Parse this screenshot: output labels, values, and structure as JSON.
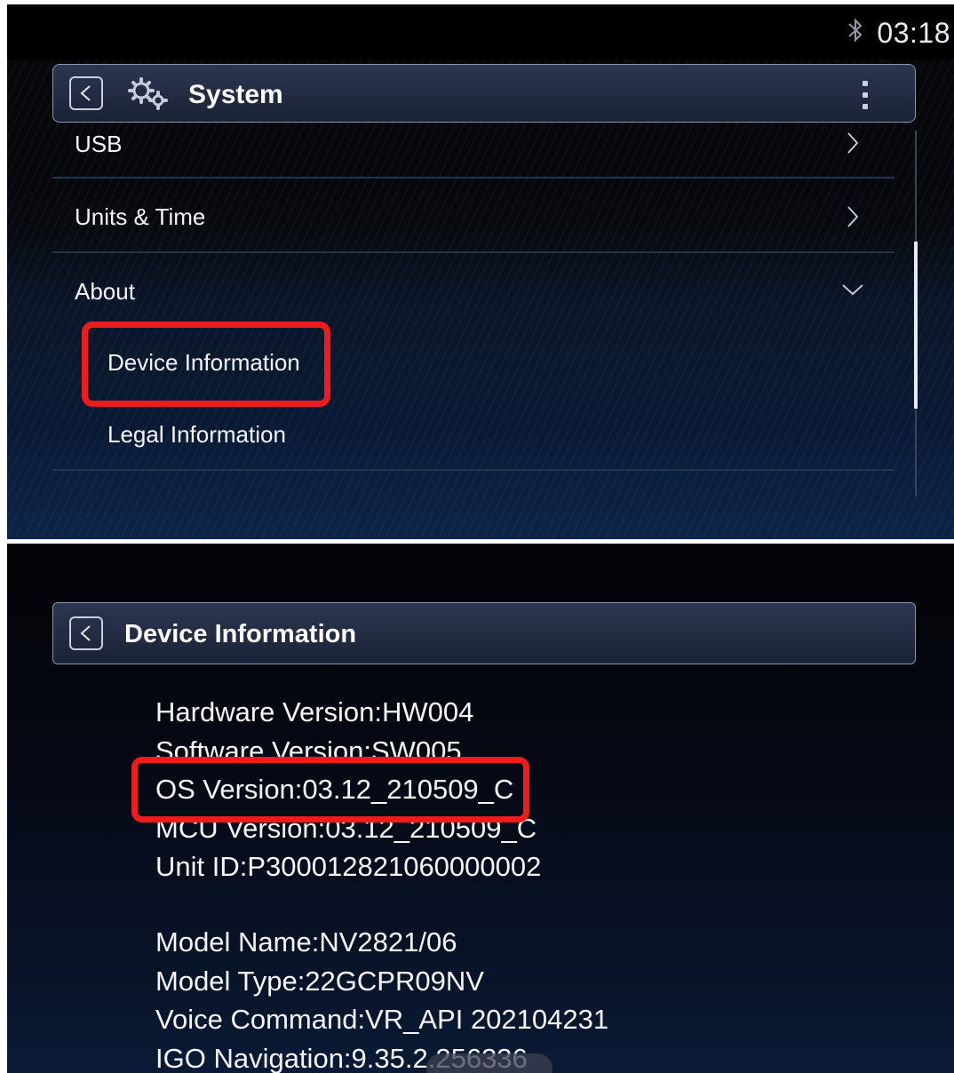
{
  "system_screen": {
    "status": {
      "clock": "03:18"
    },
    "header": {
      "title": "System"
    },
    "menu": [
      {
        "label": "USB"
      },
      {
        "label": "Units & Time"
      },
      {
        "label": "About"
      }
    ],
    "about_items": [
      {
        "label": "Device Information"
      },
      {
        "label": "Legal Information"
      }
    ]
  },
  "device_info_screen": {
    "header": {
      "title": "Device Information"
    },
    "lines": [
      "Hardware Version:HW004",
      "Software Version:SW005",
      "OS Version:03.12_210509_C",
      "MCU Version:03.12_210509_C",
      "Unit ID:P300012821060000002",
      "Model Name:NV2821/06",
      "Model Type:22GCPR09NV",
      "Voice Command:VR_API 202104231",
      "IGO Navigation:9.35.2.256336"
    ]
  },
  "colors": {
    "highlight": "#ee1c1c",
    "panel_border": "#8a97ad",
    "text": "#ffffff"
  },
  "icons": [
    "bluetooth-icon",
    "back-icon",
    "gear-icon",
    "more-vert-icon",
    "chevron-right-icon",
    "chevron-down-icon"
  ]
}
